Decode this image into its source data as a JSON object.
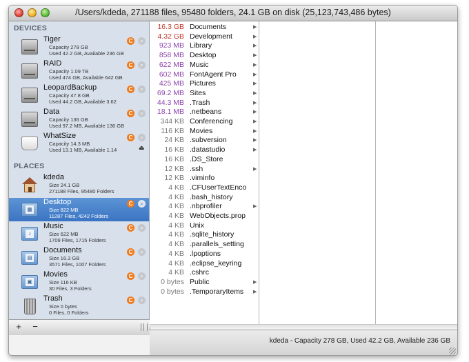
{
  "window": {
    "title": "/Users/kdeda, 271188 files, 95480 folders, 24.1 GB on disk (25,123,743,486 bytes)"
  },
  "sidebar": {
    "devices_header": "DEVICES",
    "places_header": "PLACES",
    "devices": [
      {
        "name": "Tiger",
        "line1": "Capacity 278 GB",
        "line2": "Used 42.2 GB, Available 236 GB",
        "icon": "hard-disk-icon"
      },
      {
        "name": "RAID",
        "line1": "Capacity 1.09 TB",
        "line2": "Used 474 GB, Available 642 GB",
        "icon": "hard-disk-icon"
      },
      {
        "name": "LeopardBackup",
        "line1": "Capacity 47.8 GB",
        "line2": "Used 44.2 GB, Available 3.62",
        "icon": "hard-disk-icon"
      },
      {
        "name": "Data",
        "line1": "Capacity 136 GB",
        "line2": "Used 97.2 MB, Available 136 GB",
        "icon": "hard-disk-icon"
      },
      {
        "name": "WhatSize",
        "line1": "Capacity 14.3 MB",
        "line2": "Used 13.1 MB, Available 1.14",
        "icon": "removable-drive-icon"
      }
    ],
    "places": [
      {
        "name": "kdeda",
        "line1": "Size 24.1 GB",
        "line2": "271188 Files, 95480 Folders",
        "icon": "home-icon"
      },
      {
        "name": "Desktop",
        "line1": "Size 822 MB",
        "line2": "11287 Files, 4242 Folders",
        "icon": "desktop-folder-icon"
      },
      {
        "name": "Music",
        "line1": "Size 622 MB",
        "line2": "1709 Files, 1715 Folders",
        "icon": "music-folder-icon"
      },
      {
        "name": "Documents",
        "line1": "Size 16.3 GB",
        "line2": "3571 Files, 1007 Folders",
        "icon": "documents-folder-icon"
      },
      {
        "name": "Movies",
        "line1": "Size 116 KB",
        "line2": "30 Files, 3 Folders",
        "icon": "movies-folder-icon"
      },
      {
        "name": "Trash",
        "line1": "Size 0 bytes",
        "line2": "0 Files, 0 Folders",
        "icon": "trash-icon"
      }
    ],
    "add_label": "+",
    "remove_label": "−"
  },
  "files": [
    {
      "size": "16.3 GB",
      "name": "Documents",
      "has_arrow": true,
      "color": "#c0392b"
    },
    {
      "size": "4.32 GB",
      "name": "Development",
      "has_arrow": true,
      "color": "#c0392b"
    },
    {
      "size": "923 MB",
      "name": "Library",
      "has_arrow": true,
      "color": "#8e44ad"
    },
    {
      "size": "858 MB",
      "name": "Desktop",
      "has_arrow": true,
      "color": "#8e44ad"
    },
    {
      "size": "622 MB",
      "name": "Music",
      "has_arrow": true,
      "color": "#8e44ad"
    },
    {
      "size": "602 MB",
      "name": "FontAgent Pro",
      "has_arrow": true,
      "color": "#8e44ad"
    },
    {
      "size": "425 MB",
      "name": "Pictures",
      "has_arrow": true,
      "color": "#8e44ad"
    },
    {
      "size": "69.2 MB",
      "name": "Sites",
      "has_arrow": true,
      "color": "#8e44ad"
    },
    {
      "size": "44.3 MB",
      "name": ".Trash",
      "has_arrow": true,
      "color": "#8e44ad"
    },
    {
      "size": "18.1 MB",
      "name": ".netbeans",
      "has_arrow": true,
      "color": "#8e44ad"
    },
    {
      "size": "344 KB",
      "name": "Conferencing",
      "has_arrow": true,
      "color": "#777777"
    },
    {
      "size": "116 KB",
      "name": "Movies",
      "has_arrow": true,
      "color": "#777777"
    },
    {
      "size": "24 KB",
      "name": ".subversion",
      "has_arrow": true,
      "color": "#777777"
    },
    {
      "size": "16 KB",
      "name": ".datastudio",
      "has_arrow": true,
      "color": "#777777"
    },
    {
      "size": "16 KB",
      "name": ".DS_Store",
      "has_arrow": false,
      "color": "#777777"
    },
    {
      "size": "12 KB",
      "name": ".ssh",
      "has_arrow": true,
      "color": "#777777"
    },
    {
      "size": "12 KB",
      "name": ".viminfo",
      "has_arrow": false,
      "color": "#777777"
    },
    {
      "size": "4 KB",
      "name": ".CFUserTextEnco",
      "has_arrow": false,
      "color": "#777777"
    },
    {
      "size": "4 KB",
      "name": ".bash_history",
      "has_arrow": false,
      "color": "#777777"
    },
    {
      "size": "4 KB",
      "name": ".nbprofiler",
      "has_arrow": true,
      "color": "#777777"
    },
    {
      "size": "4 KB",
      "name": "WebObjects.prop",
      "has_arrow": false,
      "color": "#777777"
    },
    {
      "size": "4 KB",
      "name": "Unix",
      "has_arrow": false,
      "color": "#777777"
    },
    {
      "size": "4 KB",
      "name": ".sqlite_history",
      "has_arrow": false,
      "color": "#777777"
    },
    {
      "size": "4 KB",
      "name": ".parallels_setting",
      "has_arrow": false,
      "color": "#777777"
    },
    {
      "size": "4 KB",
      "name": ".lpoptions",
      "has_arrow": false,
      "color": "#777777"
    },
    {
      "size": "4 KB",
      "name": ".eclipse_keyring",
      "has_arrow": false,
      "color": "#777777"
    },
    {
      "size": "4 KB",
      "name": ".cshrc",
      "has_arrow": false,
      "color": "#777777"
    },
    {
      "size": "0 bytes",
      "name": "Public",
      "has_arrow": true,
      "color": "#777777"
    },
    {
      "size": "0 bytes",
      "name": ".TemporaryItems",
      "has_arrow": true,
      "color": "#777777"
    }
  ],
  "status": {
    "text": "kdeda - Capacity 278 GB, Used 42.2 GB, Available 236 GB"
  }
}
